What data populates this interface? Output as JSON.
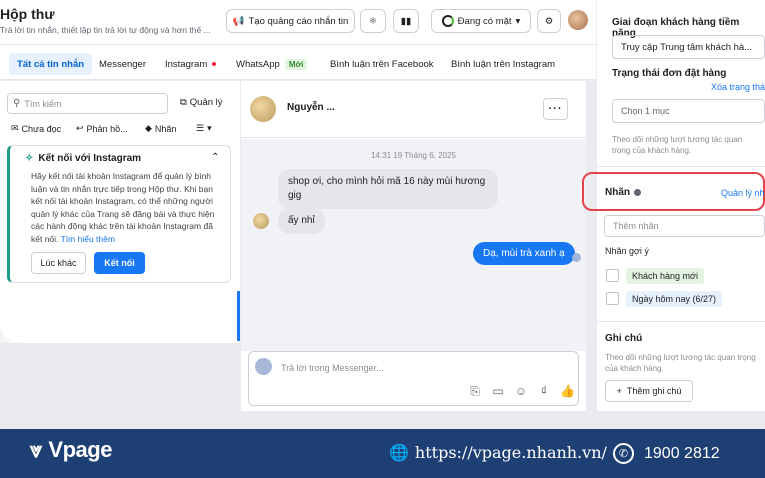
{
  "header": {
    "title": "Hộp thư",
    "subtitle": "Trả lời tin nhắn, thiết lập tin trả lời tự động và hơn thế ...",
    "ad_button": "Tạo quảng cáo nhắn tin",
    "status": "Đang có mặt"
  },
  "tabs": [
    {
      "label": "Tất cả tin nhắn"
    },
    {
      "label": "Messenger"
    },
    {
      "label": "Instagram"
    },
    {
      "label": "WhatsApp",
      "badge": "Mới"
    },
    {
      "label": "Bình luận trên Facebook"
    },
    {
      "label": "Bình luận trên Instagram"
    }
  ],
  "sidebar": {
    "search_placeholder": "Tìm kiếm",
    "manage": "Quản lý",
    "filters": [
      "Chưa đọc",
      "Phản hồ...",
      "Nhãn"
    ],
    "ig_card": {
      "title": "Kết nối với Instagram",
      "body": "Hãy kết nối tài khoản Instagram để quản lý bình luận và tin nhắn trực tiếp trong Hộp thư. Khi bạn kết nối tài khoản Instagram, có thể những người quản lý khác của Trang sẽ đăng bài và thực hiện các hành động khác trên tài khoản Instagram đã kết nối.",
      "link": "Tìm hiểu thêm",
      "later": "Lúc khác",
      "connect": "Kết nối"
    }
  },
  "chat": {
    "contact_name": "Nguyễn ...",
    "timestamp": "14:31 19 Tháng 6, 2025",
    "messages": [
      {
        "from": "in",
        "text": "shop ơi, cho mình hỏi mã 16 này mùi hương gig"
      },
      {
        "from": "in",
        "text": "ấy nhỉ"
      },
      {
        "from": "out",
        "text": "Dạ, mùi trà xanh ạ"
      }
    ],
    "composer_placeholder": "Trả lời trong Messenger..."
  },
  "right_panel": {
    "stage_label": "Giai đoạn khách hàng tiềm năng",
    "stage_value": "Truy cập Trung tâm khách hà...",
    "order_label": "Trạng thái đơn đặt hàng",
    "clear_link": "Xóa trạng thá",
    "order_value": "Chọn 1 mục",
    "order_note": "Theo dõi những lượt tương tác quan trọng của khách hàng.",
    "tags_label": "Nhãn",
    "tags_manage": "Quản lý nh",
    "tag_placeholder": "Thêm nhãn",
    "suggest_label": "Nhãn gợi ý",
    "suggestions": [
      "Khách hàng mới",
      "Ngày hôm nay (6/27)"
    ],
    "notes_label": "Ghi chú",
    "notes_note": "Theo dõi những lượt tương tác quan trọng của khách hàng.",
    "add_note": "Thêm ghi chú"
  },
  "footer": {
    "brand": "Vpage",
    "website": "https://vpage.nhanh.vn/",
    "phone": "1900 2812"
  },
  "colors": {
    "accent": "#1877f2",
    "footer_bg": "#1e3f73",
    "highlight": "#e4424a",
    "ig_border": "#1b9f8b"
  }
}
